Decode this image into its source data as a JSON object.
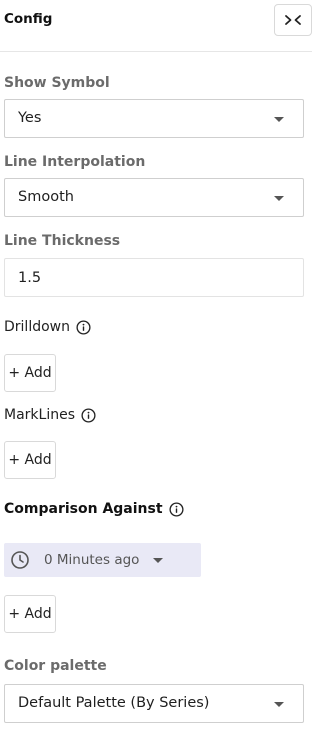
{
  "header": {
    "title": "Config",
    "collapse_icon": "collapse-arrows-icon"
  },
  "show_symbol": {
    "label": "Show Symbol",
    "value": "Yes"
  },
  "line_interpolation": {
    "label": "Line Interpolation",
    "value": "Smooth"
  },
  "line_thickness": {
    "label": "Line Thickness",
    "value": "1.5"
  },
  "drilldown": {
    "label": "Drilldown",
    "add_label": "+ Add"
  },
  "marklines": {
    "label": "MarkLines",
    "add_label": "+ Add"
  },
  "comparison": {
    "label": "Comparison Against",
    "time_value": "0 Minutes ago",
    "add_label": "+ Add"
  },
  "color_palette": {
    "label": "Color palette",
    "value": "Default Palette (By Series)"
  },
  "colors": {
    "chip_bg": "#e9e9f6",
    "border": "#cfcfcf",
    "muted_label": "#6b6b6b"
  }
}
